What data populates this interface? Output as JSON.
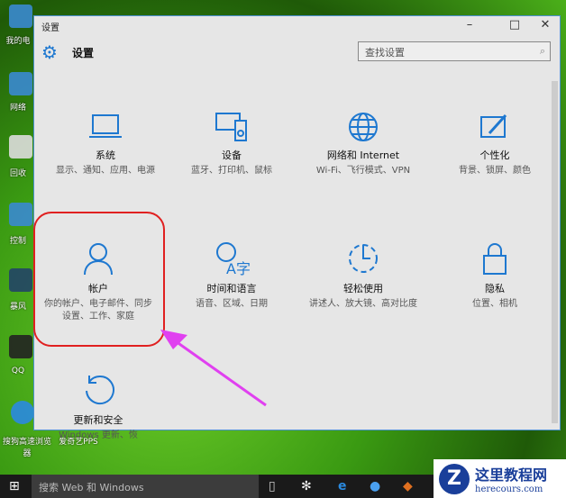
{
  "desktop": {
    "icons": [
      "我的电",
      "网络",
      "回收",
      "控制",
      "暴风",
      "QQ",
      "搜狗高速浏览器",
      "爱奇艺PPS"
    ]
  },
  "window": {
    "title": "设置",
    "header": "设置",
    "search_placeholder": "查找设置",
    "tiles": [
      {
        "title": "系统",
        "desc": "显示、通知、应用、电源"
      },
      {
        "title": "设备",
        "desc": "蓝牙、打印机、鼠标"
      },
      {
        "title": "网络和 Internet",
        "desc": "Wi-Fi、飞行模式、VPN"
      },
      {
        "title": "个性化",
        "desc": "背景、锁屏、颜色"
      },
      {
        "title": "帐户",
        "desc": "你的帐户、电子邮件、同步设置、工作、家庭"
      },
      {
        "title": "时间和语言",
        "desc": "语音、区域、日期"
      },
      {
        "title": "轻松使用",
        "desc": "讲述人、放大镜、高对比度"
      },
      {
        "title": "隐私",
        "desc": "位置、相机"
      },
      {
        "title": "更新和安全",
        "desc": "Windows 更新、恢"
      }
    ]
  },
  "taskbar": {
    "search": "搜索 Web 和 Windows"
  },
  "watermark": {
    "title": "这里教程网",
    "url": "herecours.com"
  }
}
